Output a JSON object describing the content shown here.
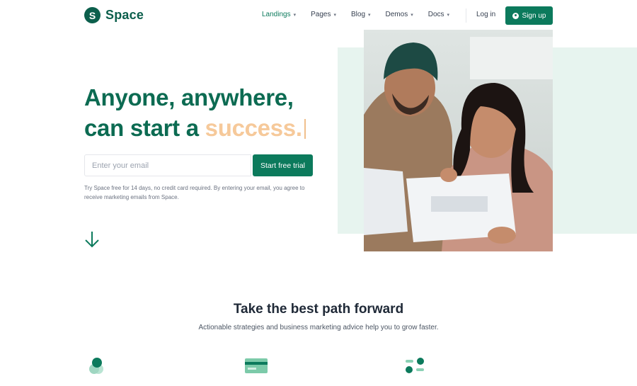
{
  "brand": {
    "mark": "S",
    "name": "Space"
  },
  "nav": {
    "items": [
      {
        "label": "Landings",
        "active": true
      },
      {
        "label": "Pages",
        "active": false
      },
      {
        "label": "Blog",
        "active": false
      },
      {
        "label": "Demos",
        "active": false
      },
      {
        "label": "Docs",
        "active": false
      }
    ],
    "login": "Log in",
    "signup": "Sign up"
  },
  "hero": {
    "line1": "Anyone, anywhere,",
    "line2_prefix": "can start a ",
    "line2_highlight": "success.",
    "email_placeholder": "Enter your email",
    "cta": "Start free trial",
    "disclaimer": "Try Space free for 14 days, no credit card required. By entering your email, you agree to receive marketing emails from Space."
  },
  "section": {
    "title": "Take the best path forward",
    "subtitle": "Actionable strategies and business marketing advice help you to grow faster."
  },
  "colors": {
    "brand": "#0c7a5c",
    "brand_dark": "#0c5f4c",
    "highlight": "#f6c99a",
    "hero_tint": "#e7f4ef"
  },
  "icons": [
    "chevron-down-icon",
    "user-icon",
    "arrow-down-icon",
    "circles-icon",
    "credit-card-icon",
    "toggles-icon"
  ]
}
